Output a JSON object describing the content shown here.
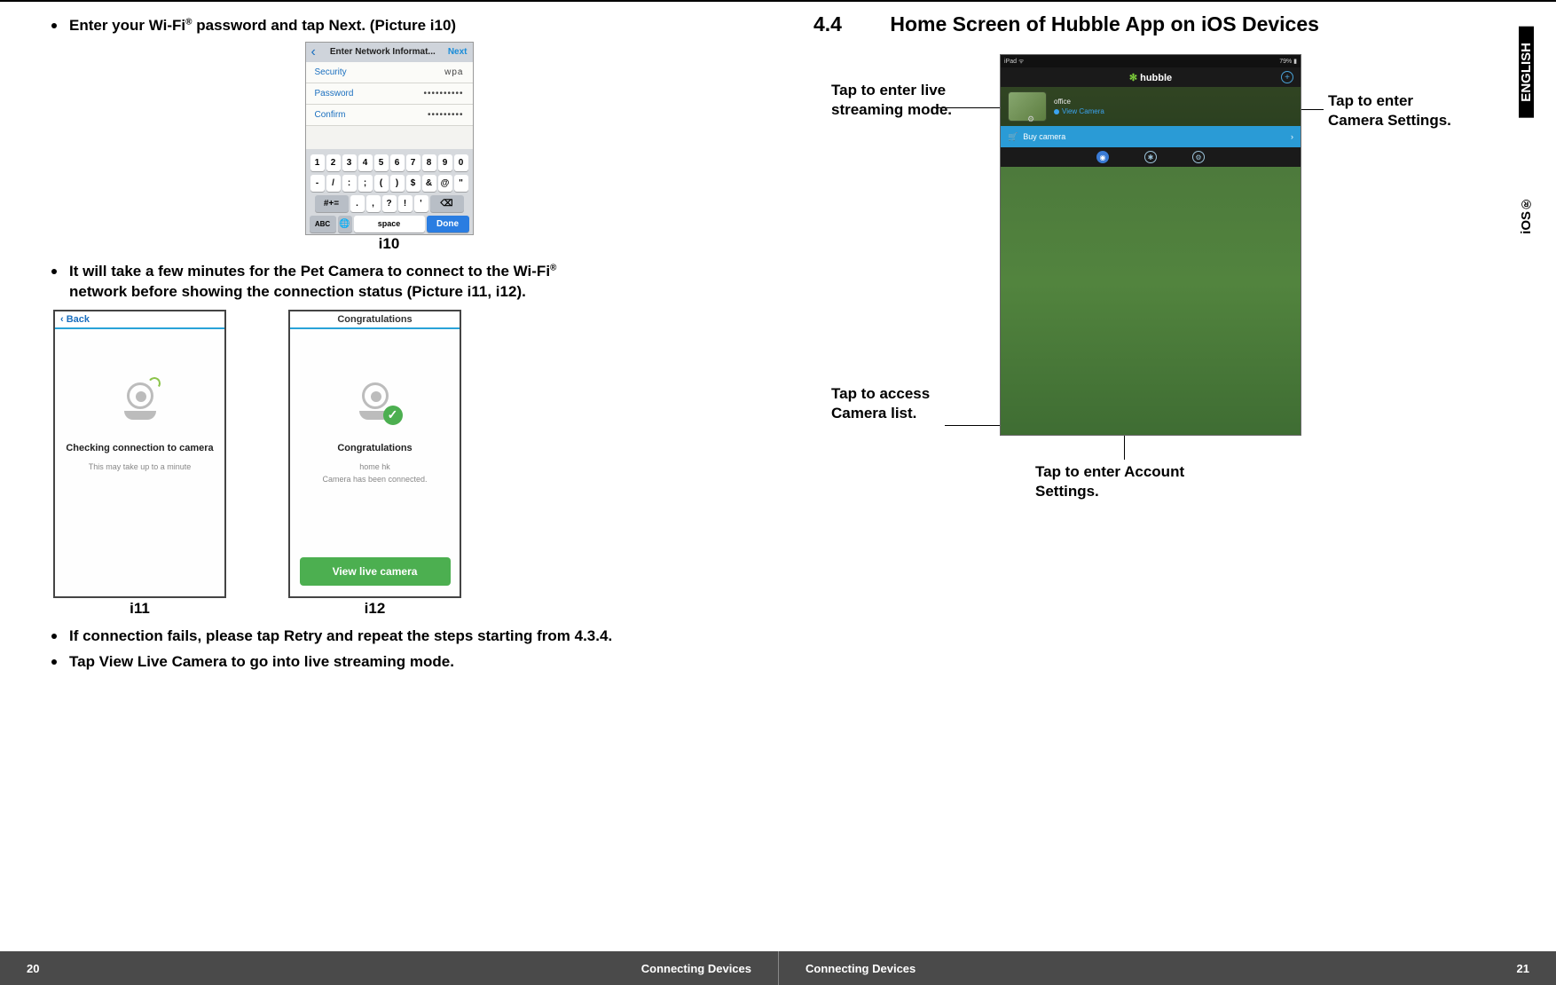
{
  "left": {
    "bullets": {
      "b1_pre": "Enter your Wi-Fi",
      "b1_post": " password and  tap  Next. (Picture i10)",
      "b2_pre": "It will take a few minutes for the Pet Camera  to connect to the Wi-Fi",
      "b2_post": "network before showing the connection status (Picture  i11, i12).",
      "b3": "If connection fails, please  tap  Retry and repeat  the steps starting from 4.3.4.",
      "b4": "Tap  View Live Camera to go into live streaming mode."
    },
    "i10": {
      "caption": "i10",
      "nav_title": "Enter Network Informat...",
      "nav_next": "Next",
      "security_label": "Security",
      "security_value": "wpa",
      "password_label": "Password",
      "password_value": "••••••••••",
      "confirm_label": "Confirm",
      "confirm_value": "•••••••••",
      "keys_row1": [
        "1",
        "2",
        "3",
        "4",
        "5",
        "6",
        "7",
        "8",
        "9",
        "0"
      ],
      "keys_row2": [
        "-",
        "/",
        ":",
        ";",
        "(",
        ")",
        "$",
        "&",
        "@",
        "\""
      ],
      "keys_row3": [
        "#+=",
        ".",
        ",",
        "?",
        "!",
        "'",
        "⌫"
      ],
      "abc": "ABC",
      "globe": "🌐",
      "space": "space",
      "done": "Done"
    },
    "i11": {
      "caption": "i11",
      "back": "Back",
      "line1": "Checking connection to camera",
      "line2": "This may take up to a minute"
    },
    "i12": {
      "caption": "i12",
      "title": "Congratulations",
      "line1": "Congratulations",
      "line2": "home hk",
      "line3": "Camera has been connected.",
      "button": "View live camera"
    }
  },
  "right": {
    "heading_num": "4.4",
    "heading_text": "Home Screen of Hubble App on iOS Devices",
    "callouts": {
      "c1": "Tap to enter live streaming mode.",
      "c2": "Tap to enter Camera Settings.",
      "c3": "Tap to access Camera list.",
      "c4": "Tap to enter Account Settings."
    },
    "tablet": {
      "status_left": "iPad ᯤ",
      "status_right": "79% ▮",
      "app_logo_prefix": "✼ ",
      "app_logo": "hubble",
      "cam_name": "office",
      "cam_status": "View Camera",
      "buy_label": "Buy camera"
    },
    "side_tab": "ENGLISH",
    "side_label": "iOS®"
  },
  "footer": {
    "left_page": "20",
    "right_page": "21",
    "label": "Connecting Devices"
  },
  "reg": "®"
}
